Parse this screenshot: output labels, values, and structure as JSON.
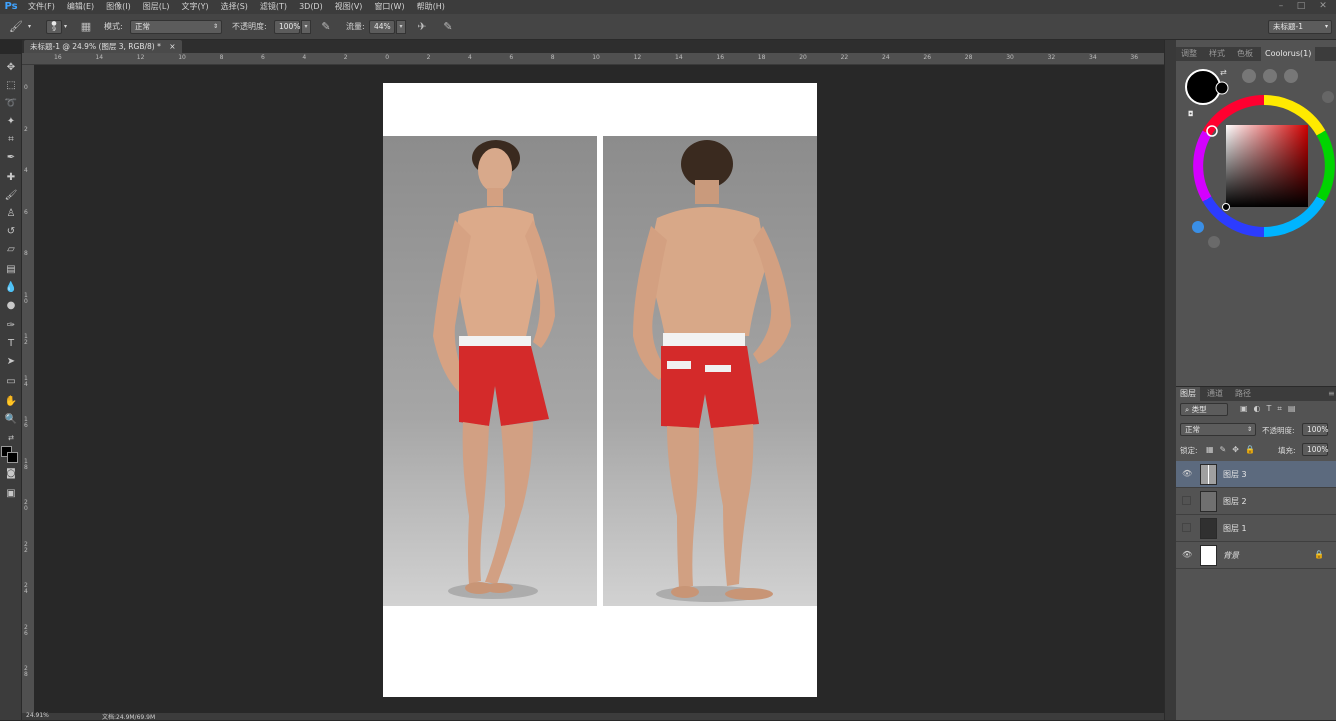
{
  "app": {
    "logo": "Ps"
  },
  "menu": [
    "文件(F)",
    "编辑(E)",
    "图像(I)",
    "图层(L)",
    "文字(Y)",
    "选择(S)",
    "滤镜(T)",
    "3D(D)",
    "视图(V)",
    "窗口(W)",
    "帮助(H)"
  ],
  "options": {
    "brush_size": "9",
    "mode_label": "模式:",
    "mode_value": "正常",
    "opacity_label": "不透明度:",
    "opacity_value": "100%",
    "flow_label": "流量:",
    "flow_value": "44%",
    "workspace": "未标题-1"
  },
  "document": {
    "tab_title": "未标题-1 @ 24.9% (图层 3, RGB/8) *",
    "close": "×"
  },
  "ruler": {
    "top": [
      "16",
      "14",
      "12",
      "10",
      "8",
      "6",
      "4",
      "2",
      "0",
      "2",
      "4",
      "6",
      "8",
      "10",
      "12",
      "14",
      "16",
      "18",
      "20",
      "22",
      "24",
      "26",
      "28",
      "30",
      "32",
      "34",
      "36"
    ],
    "left": [
      "0",
      "2",
      "4",
      "6",
      "8",
      "1\n0",
      "1\n2",
      "1\n4",
      "1\n6",
      "1\n8",
      "2\n0",
      "2\n2",
      "2\n4",
      "2\n6",
      "2\n8"
    ]
  },
  "status": {
    "zoom": "24.91%",
    "doc": "文档:24.9M/69.9M"
  },
  "color_panel": {
    "tabs": [
      "调整",
      "样式",
      "色板",
      "Coolorus(1)"
    ],
    "active_tab": "Coolorus(1)",
    "foreground": "#000000",
    "hue_color": "#ff0000"
  },
  "layers_panel": {
    "tabs": [
      "图层",
      "通道",
      "路径"
    ],
    "filter_label": "类型",
    "blend_mode": "正常",
    "opacity_label": "不透明度:",
    "opacity_value": "100%",
    "lock_label": "锁定:",
    "fill_label": "填充:",
    "fill_value": "100%",
    "layers": [
      {
        "name": "图层 3",
        "visible": true,
        "active": true
      },
      {
        "name": "图层 2",
        "visible": false,
        "active": false
      },
      {
        "name": "图层 1",
        "visible": false,
        "active": false
      },
      {
        "name": "背景",
        "visible": true,
        "active": false,
        "locked": true
      }
    ]
  }
}
